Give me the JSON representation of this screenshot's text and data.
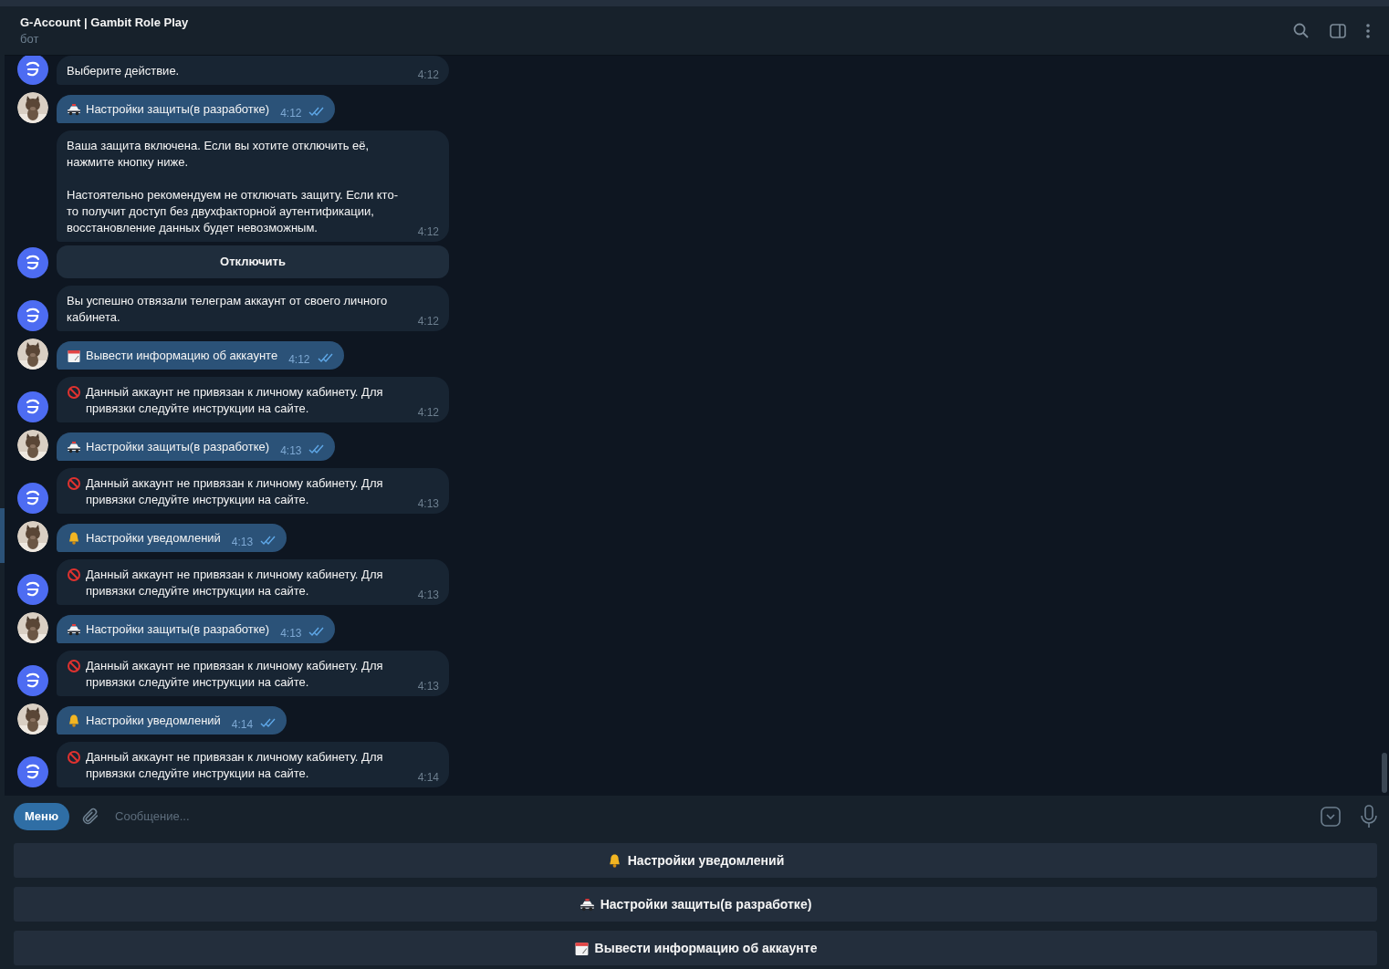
{
  "header": {
    "title": "G-Account | Gambit Role Play",
    "subtitle": "бот"
  },
  "messages": [
    {
      "kind": "bot",
      "text": "Выберите действие.",
      "time": "4:12"
    },
    {
      "kind": "user",
      "emoji": {
        "kind": "car"
      },
      "text": "Настройки защиты(в разработке)",
      "time": "4:12",
      "read": true
    },
    {
      "kind": "bot",
      "text": "Ваша защита включена. Если вы хотите отключить её, нажмите кнопку ниже.\n\nНастоятельно рекомендуем не отключать защиту. Если кто-то получит доступ без двухфакторной аутентификации, восстановление данных будет невозможным.",
      "time": "4:12",
      "buttons": [
        "Отключить"
      ]
    },
    {
      "kind": "bot",
      "text": "Вы успешно отвязали телеграм аккаунт от своего личного кабинета.",
      "time": "4:12"
    },
    {
      "kind": "user",
      "emoji": {
        "kind": "calendar"
      },
      "text": "Вывести информацию об аккаунте",
      "time": "4:12",
      "read": true
    },
    {
      "kind": "bot",
      "emoji": {
        "kind": "forbidden"
      },
      "text": "Данный аккаунт не привязан к личному кабинету. Для привязки следуйте инструкции на сайте.",
      "time": "4:12"
    },
    {
      "kind": "user",
      "emoji": {
        "kind": "car"
      },
      "text": "Настройки защиты(в разработке)",
      "time": "4:13",
      "read": true
    },
    {
      "kind": "bot",
      "emoji": {
        "kind": "forbidden"
      },
      "text": "Данный аккаунт не привязан к личному кабинету. Для привязки следуйте инструкции на сайте.",
      "time": "4:13"
    },
    {
      "kind": "user",
      "emoji": {
        "kind": "bell"
      },
      "text": "Настройки уведомлений",
      "time": "4:13",
      "read": true
    },
    {
      "kind": "bot",
      "emoji": {
        "kind": "forbidden"
      },
      "text": "Данный аккаунт не привязан к личному кабинету. Для привязки следуйте инструкции на сайте.",
      "time": "4:13"
    },
    {
      "kind": "user",
      "emoji": {
        "kind": "car"
      },
      "text": "Настройки защиты(в разработке)",
      "time": "4:13",
      "read": true
    },
    {
      "kind": "bot",
      "emoji": {
        "kind": "forbidden"
      },
      "text": "Данный аккаунт не привязан к личному кабинету. Для привязки следуйте инструкции на сайте.",
      "time": "4:13"
    },
    {
      "kind": "user",
      "emoji": {
        "kind": "bell"
      },
      "text": "Настройки уведомлений",
      "time": "4:14",
      "read": true
    },
    {
      "kind": "bot",
      "emoji": {
        "kind": "forbidden"
      },
      "text": "Данный аккаунт не привязан к личному кабинету. Для привязки следуйте инструкции на сайте.",
      "time": "4:14"
    }
  ],
  "composer": {
    "menu_label": "Меню",
    "placeholder": "Сообщение..."
  },
  "keyboard": [
    {
      "emoji": {
        "kind": "bell"
      },
      "label": "Настройки уведомлений"
    },
    {
      "emoji": {
        "kind": "car"
      },
      "label": "Настройки защиты(в разработке)"
    },
    {
      "emoji": {
        "kind": "calendar"
      },
      "label": "Вывести информацию об аккаунте"
    }
  ]
}
